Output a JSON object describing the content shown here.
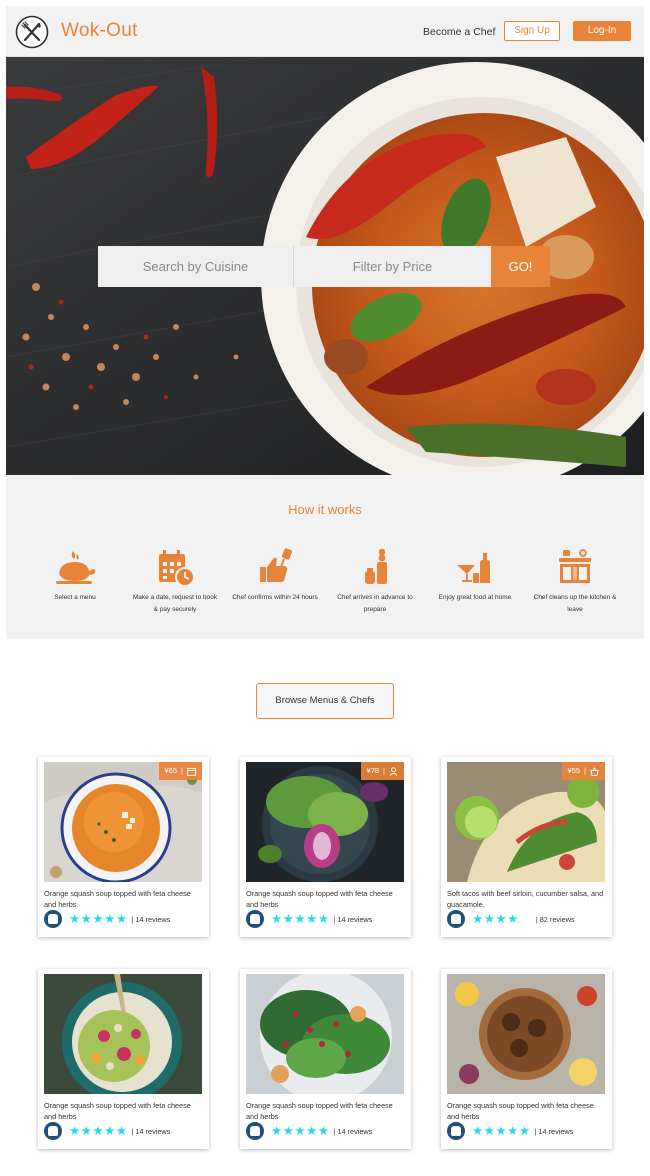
{
  "header": {
    "brand": "Wok-Out",
    "become_chef": "Become a Chef",
    "signup": "Sign Up",
    "login": "Log-In",
    "logo_icon": "fork-knife-icon"
  },
  "hero": {
    "search_placeholder": "Search by Cuisine",
    "filter_placeholder": "Filter by Price",
    "go_label": "GO!"
  },
  "how": {
    "title": "How it works",
    "steps": [
      {
        "label": "Select a menu",
        "icon": "roast-chicken-icon"
      },
      {
        "label": "Make a date, request to book & pay securely",
        "icon": "calendar-clock-icon"
      },
      {
        "label": "Chef confirms within 24 hours",
        "icon": "thumbs-up-spatula-icon"
      },
      {
        "label": "Chef arrives in advance to prepare",
        "icon": "chef-icon"
      },
      {
        "label": "Enjoy great food at home",
        "icon": "cocktail-bottle-icon"
      },
      {
        "label": "Chef cleans up the kitchen & leave",
        "icon": "kitchen-icon"
      }
    ]
  },
  "browse": {
    "label": "Browse Menus & Chefs"
  },
  "colors": {
    "accent": "#e8843a",
    "stars": "#25d9e8",
    "avatar": "#1f4f7a"
  },
  "cards": [
    {
      "price": "¥65",
      "price_icon": "calendar-icon",
      "desc": "Orange squash soup topped with feta cheese and herbs",
      "rating": 5,
      "reviews": "| 14 reviews"
    },
    {
      "price": "¥78",
      "price_icon": "person-icon",
      "desc": "Orange squash soup topped with feta cheese and herbs",
      "rating": 5,
      "reviews": "| 14 reviews"
    },
    {
      "price": "¥55",
      "price_icon": "basket-icon",
      "desc": "Soft tacos with beef sirloin, cucumber salsa, and guacamole.",
      "rating": 4,
      "reviews": "| 82 reviews"
    },
    {
      "desc": "Orange squash soup topped with feta cheese and herbs",
      "rating": 5,
      "reviews": "| 14 reviews"
    },
    {
      "desc": "Orange squash soup topped with feta cheese and herbs",
      "rating": 5,
      "reviews": "| 14 reviews"
    },
    {
      "desc": "Orange squash soup topped with feta cheese and herbs",
      "rating": 5,
      "reviews": "| 14 reviews"
    }
  ]
}
